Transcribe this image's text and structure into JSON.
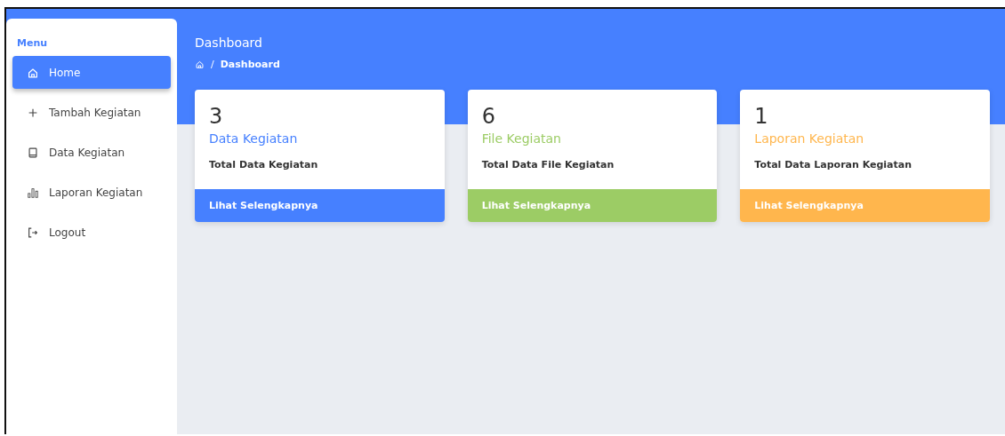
{
  "sidebar": {
    "heading": "Menu",
    "items": [
      {
        "label": "Home",
        "selected": true
      },
      {
        "label": "Tambah Kegiatan",
        "selected": false
      },
      {
        "label": "Data Kegiatan",
        "selected": false
      },
      {
        "label": "Laporan Kegiatan",
        "selected": false
      },
      {
        "label": "Logout",
        "selected": false
      }
    ]
  },
  "header": {
    "title": "Dashboard",
    "breadcrumb": {
      "separator": "/",
      "current": "Dashboard"
    }
  },
  "cards": [
    {
      "count": "3",
      "title": "Data Kegiatan",
      "subtitle": "Total Data Kegiatan",
      "link": "Lihat Selengkapnya",
      "color": "#4680ff"
    },
    {
      "count": "6",
      "title": "File Kegiatan",
      "subtitle": "Total Data File Kegiatan",
      "link": "Lihat Selengkapnya",
      "color": "#9ccc65"
    },
    {
      "count": "1",
      "title": "Laporan Kegiatan",
      "subtitle": "Total Data Laporan Kegiatan",
      "link": "Lihat Selengkapnya",
      "color": "#ffb64d"
    }
  ]
}
